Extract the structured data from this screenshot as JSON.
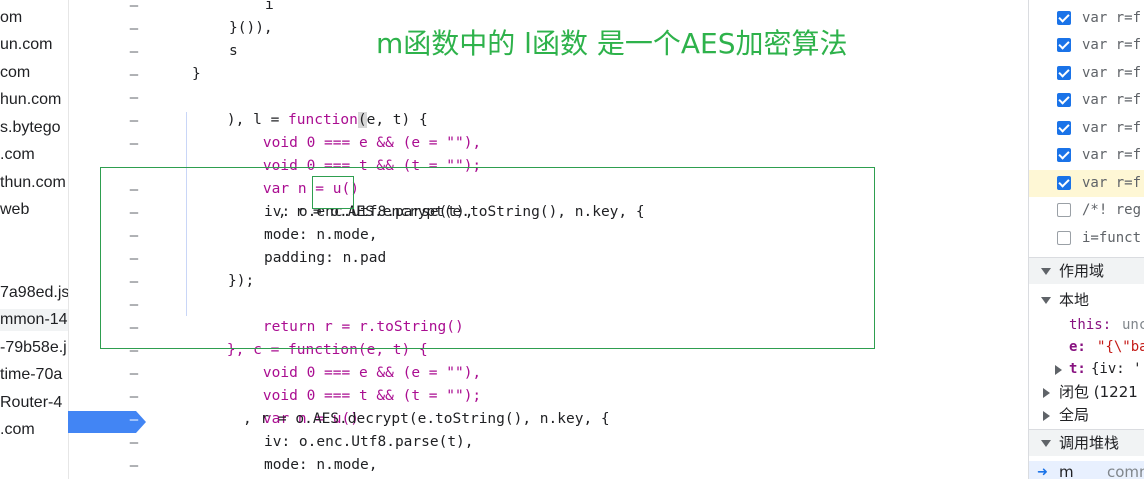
{
  "file_navigator": {
    "items": [
      {
        "label": "om"
      },
      {
        "label": "un.com"
      },
      {
        "label": "com"
      },
      {
        "label": "hun.com"
      },
      {
        "label": "s.bytego"
      },
      {
        "label": ".com"
      },
      {
        "label": "thun.com"
      },
      {
        "label": "web"
      },
      {
        "label": "7a98ed.js"
      },
      {
        "label": "mmon-14"
      },
      {
        "label": "-79b58e.j"
      },
      {
        "label": "time-70a"
      },
      {
        "label": "Router-4"
      },
      {
        "label": ".com"
      }
    ]
  },
  "annotation": {
    "text": "m函数中的 l函数  是一个AES加密算法"
  },
  "code": {
    "lines": [
      {
        "text": "i"
      },
      {
        "text": "}()),"
      },
      {
        "text": "s"
      },
      {
        "text": "}"
      },
      {
        "pre": "), l = ",
        "kw": "function",
        "mid": "(",
        "post": "e, t) {"
      },
      {
        "text": "void 0 === e && (e = \"\"),"
      },
      {
        "text": "void 0 === t && (t = \"\");"
      },
      {
        "text": "var n = u()"
      },
      {
        "pre": ", r = o.",
        "aes": "AES",
        "post": ".encrypt(e.toString(), n.key, {"
      },
      {
        "text": "iv: o.enc.Utf8.parse(t),"
      },
      {
        "text": "mode: n.mode,"
      },
      {
        "text": "padding: n.pad"
      },
      {
        "text": "});"
      },
      {
        "text": "return r = r.toString()"
      },
      {
        "text": "}, c = function(e, t) {"
      },
      {
        "text": "void 0 === e && (e = \"\"),"
      },
      {
        "text": "void 0 === t && (t = \"\");"
      },
      {
        "text": "var n = u()"
      },
      {
        "text": ", r = o.AES.decrypt(e.toString(), n.key, {"
      },
      {
        "text": "iv: o.enc.Utf8.parse(t),"
      },
      {
        "text": "mode: n.mode,"
      }
    ],
    "gutter_symbol": "–"
  },
  "debugger": {
    "breakpoints": [
      {
        "text": "var r=f",
        "checked": true
      },
      {
        "text": "var r=f",
        "checked": true
      },
      {
        "text": "var r=f",
        "checked": true
      },
      {
        "text": "var r=f",
        "checked": true
      },
      {
        "text": "var r=f",
        "checked": true
      },
      {
        "text": "var r=f",
        "checked": true
      },
      {
        "text": "var r=f",
        "checked": true
      },
      {
        "text": "/*! reg",
        "checked": false
      },
      {
        "text": "i=funct",
        "checked": false
      }
    ],
    "scope_header": "作用域",
    "local_label": "本地",
    "this_key": "this:",
    "this_val": "unc",
    "e_key": "e:",
    "e_val": "\"{\\\"ba",
    "t_key": "t:",
    "t_val": "{iv: '",
    "closure_label": "闭包 (1221",
    "global_label": "全局",
    "callstack_header": "调用堆栈",
    "callstack_item": "m",
    "callstack_file": "comm"
  },
  "colors": {
    "annotation_green": "#2eb24b",
    "keyword_purple": "#aa0d91",
    "string_red": "#c41a16",
    "breakpoint_blue": "#4285f4"
  }
}
